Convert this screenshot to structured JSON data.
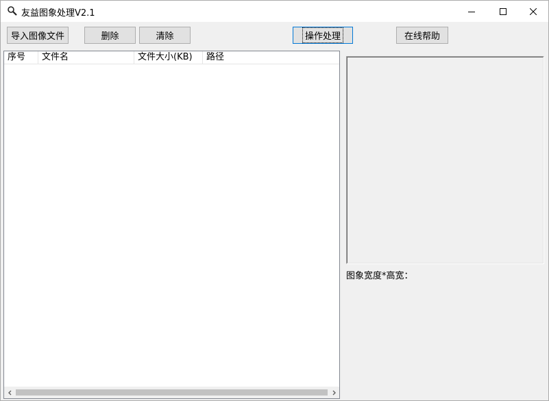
{
  "window": {
    "title": "友益图象处理V2.1",
    "icons": {
      "app": "magnifier-icon",
      "minimize": "minimize-icon",
      "maximize": "maximize-icon",
      "close": "close-icon"
    }
  },
  "toolbar": {
    "import_label": "导入图像文件",
    "delete_label": "删除",
    "clear_label": "清除",
    "process_label": "操作处理",
    "help_label": "在线帮助"
  },
  "file_list": {
    "columns": [
      "序号",
      "文件名",
      "文件大小(KB)",
      "路径"
    ],
    "rows": []
  },
  "preview": {
    "dims_label": "图象宽度*高宽："
  }
}
